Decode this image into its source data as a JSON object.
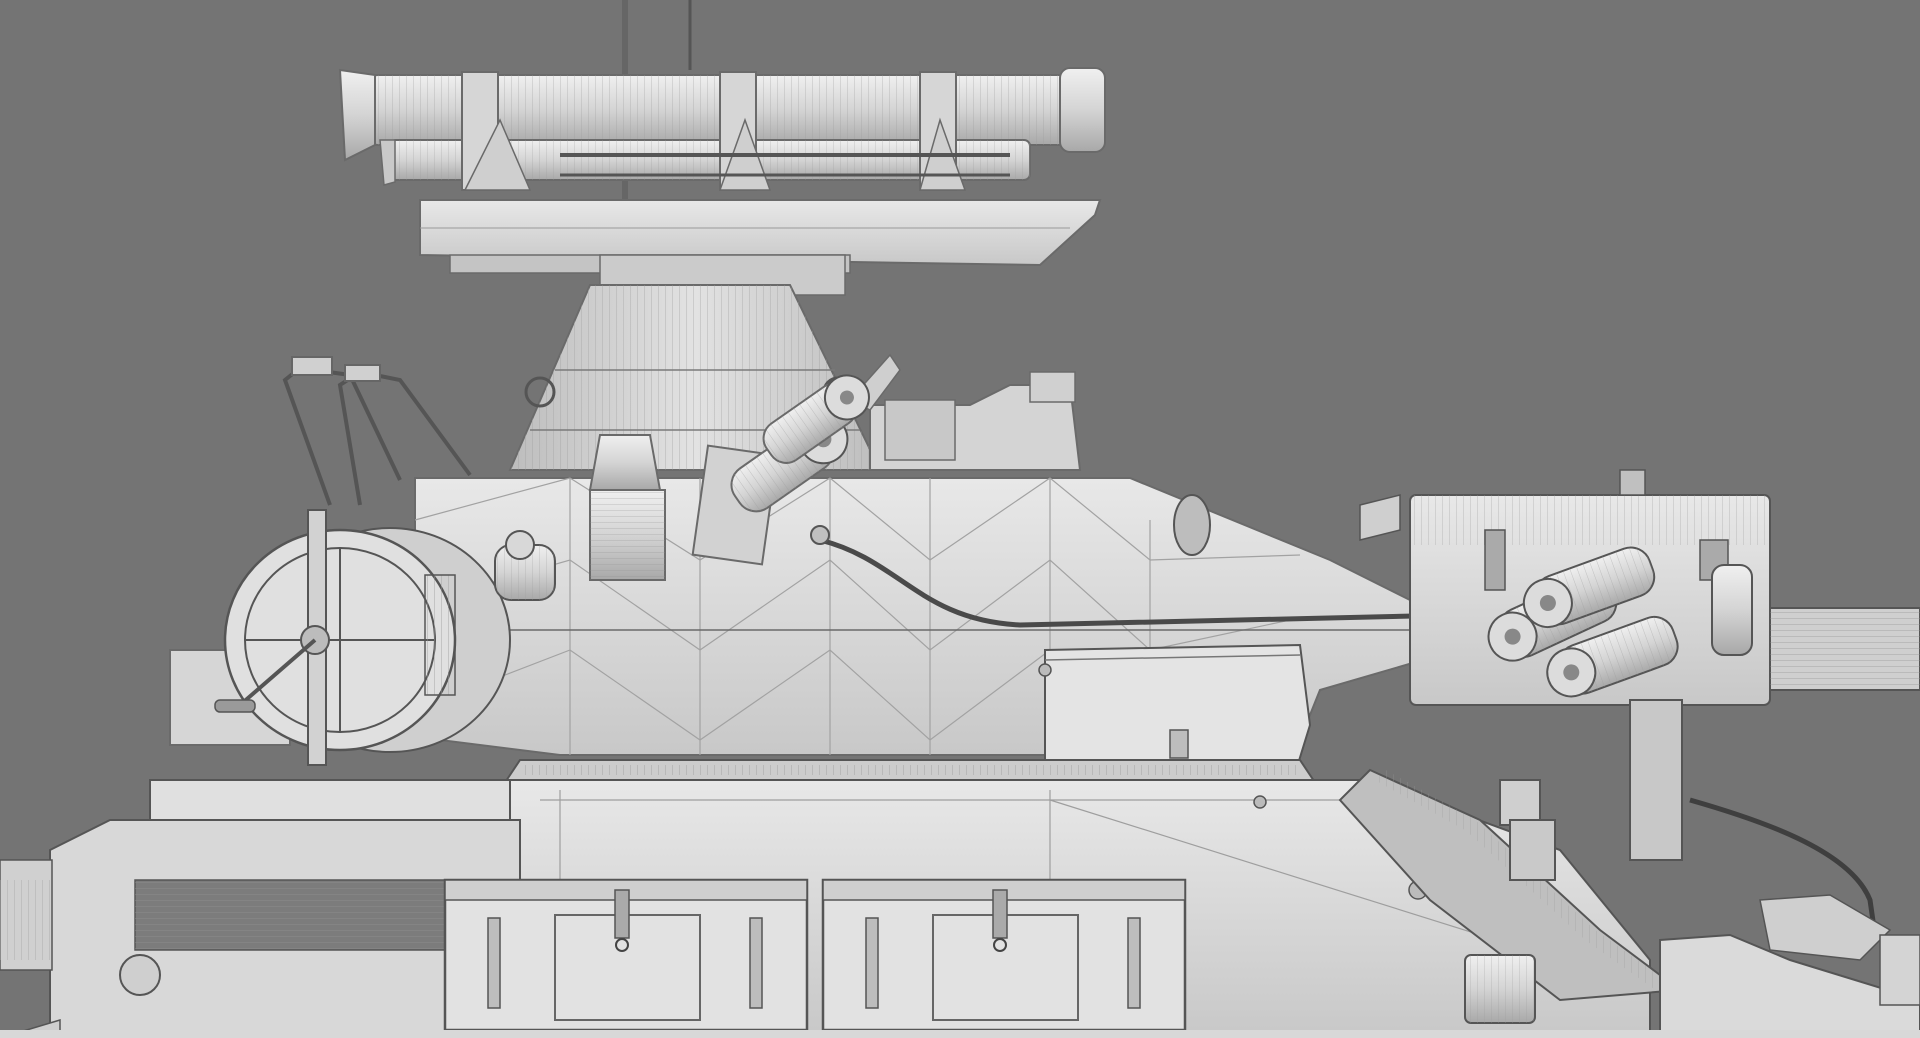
{
  "scene": {
    "background_color": "#747474",
    "model_fill": "#d9d9d9",
    "model_shadow": "#b5b5b5",
    "wire_color": "#8a8a8a",
    "outline_color": "#5c5c5c",
    "subject": "wireframe-render-tank-turret"
  }
}
